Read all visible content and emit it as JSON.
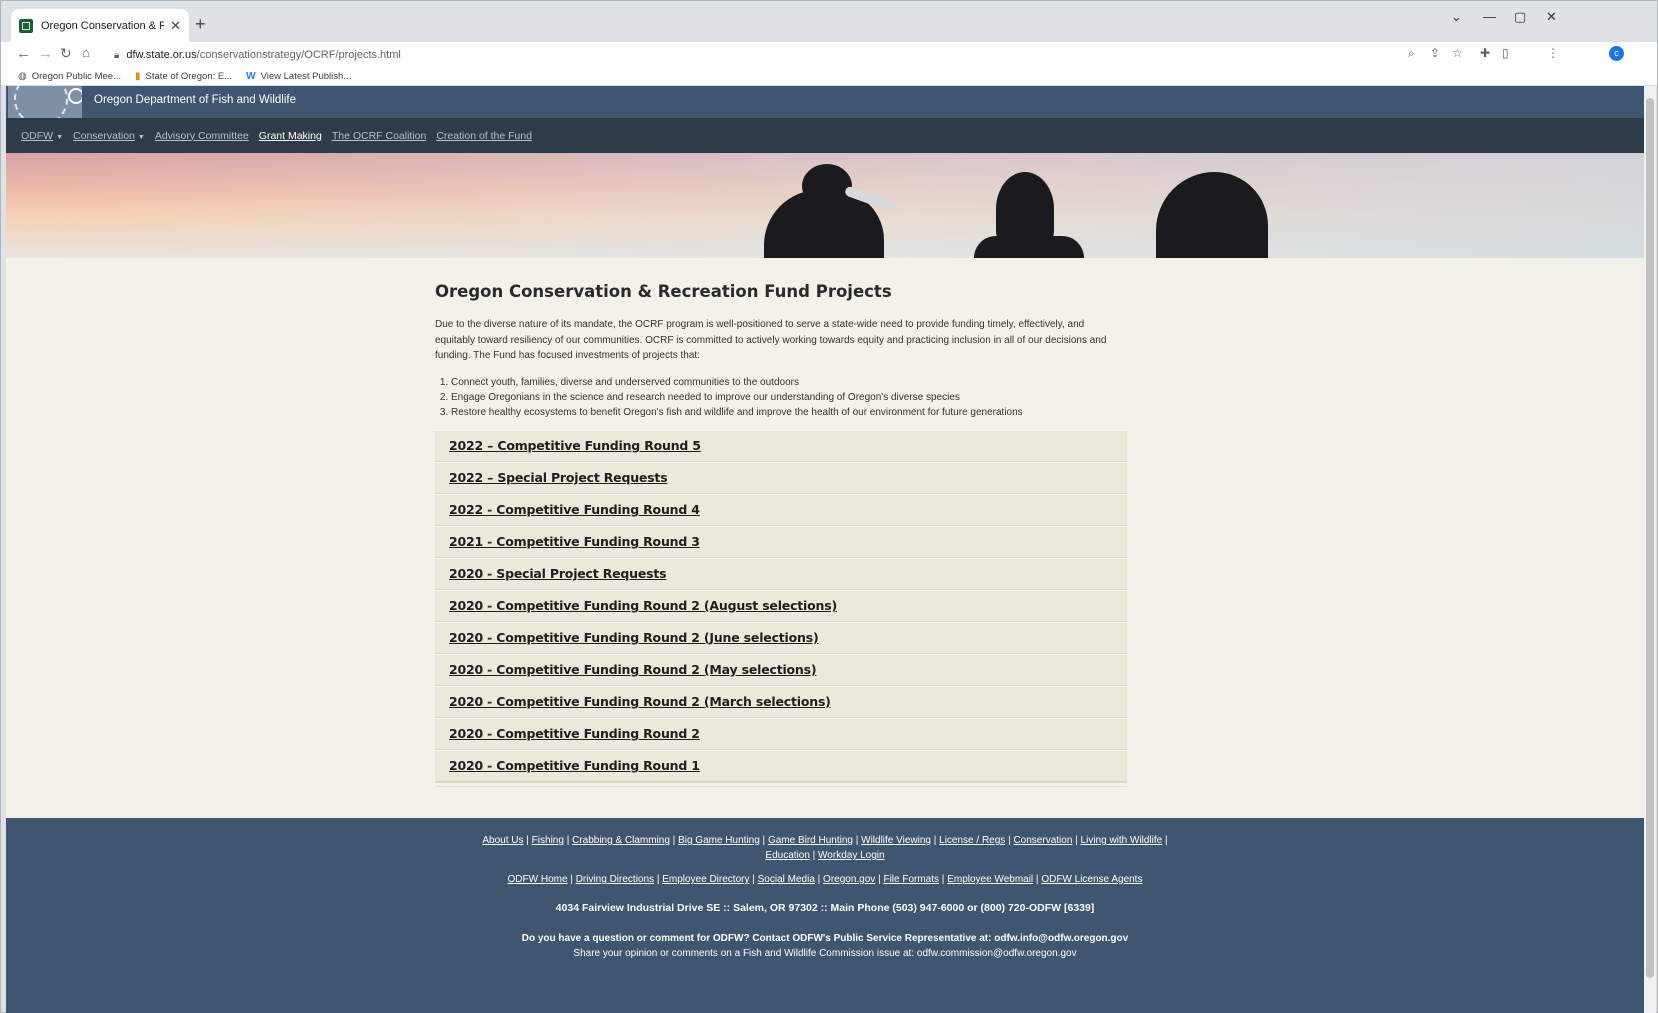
{
  "browser": {
    "tab_title": "Oregon Conservation & Recreation Fund Projects - ODFW",
    "url_host": "dfw.state.or.us",
    "url_path": "/conservationstrategy/OCRF/projects.html",
    "bookmarks": [
      {
        "label": "Oregon Public Mee...",
        "icon": "globe-icon"
      },
      {
        "label": "State of Oregon: E...",
        "icon": "oregon-flag-icon"
      },
      {
        "label": "View Latest Publish...",
        "icon": "w-logo-icon"
      }
    ],
    "profile_initial": "c",
    "accent": "#1a73e8"
  },
  "site": {
    "name": "Oregon Department of Fish and Wildlife",
    "nav": [
      {
        "label": "ODFW",
        "dropdown": true
      },
      {
        "label": "Conservation",
        "dropdown": true
      },
      {
        "label": "Advisory Committee",
        "dropdown": false
      },
      {
        "label": "Grant Making",
        "dropdown": false,
        "active": true
      },
      {
        "label": "The OCRF Coalition",
        "dropdown": false
      },
      {
        "label": "Creation of the Fund",
        "dropdown": false
      }
    ],
    "header_color": "#3f5570",
    "nav_color": "#2f3b48"
  },
  "main": {
    "title": "Oregon Conservation & Recreation Fund Projects",
    "intro": "Due to the diverse nature of its mandate, the OCRF program is well-positioned to serve a state-wide need to provide funding timely, effectively, and equitably toward resiliency of our communities. OCRF is committed to actively working towards equity and practicing inclusion in all of our decisions and funding. The Fund has focused investments of projects that:",
    "focus_items": [
      "Connect youth, families, diverse and underserved communities to the outdoors",
      "Engage Oregonians in the science and research needed to improve our understanding of Oregon's diverse species",
      "Restore healthy ecosystems to benefit Oregon's fish and wildlife and improve the health of our environment for future generations"
    ],
    "rounds": [
      "2022 – Competitive Funding Round 5",
      "2022 – Special Project Requests",
      "2022 - Competitive Funding Round 4",
      "2021 - Competitive Funding Round 3",
      "2020 - Special Project Requests",
      "2020 - Competitive Funding Round 2 (August selections)",
      "2020 - Competitive Funding Round 2 (June selections)",
      "2020 - Competitive Funding Round 2 (May selections)",
      "2020 - Competitive Funding Round 2 (March selections)",
      "2020 - Competitive Funding Round 2",
      "2020 - Competitive Funding Round 1"
    ]
  },
  "footer": {
    "links_row1": [
      "About Us",
      "Fishing",
      "Crabbing & Clamming",
      "Big Game Hunting",
      "Game Bird Hunting",
      "Wildlife Viewing",
      "License / Regs",
      "Conservation",
      "Living with Wildlife",
      "Education",
      "Workday Login"
    ],
    "links_row2": [
      "ODFW Home",
      "Driving Directions",
      "Employee Directory",
      "Social Media",
      "Oregon.gov",
      "File Formats",
      "Employee Webmail",
      "ODFW License Agents"
    ],
    "address": "4034 Fairview Industrial Drive SE  ::  Salem, OR 97302  ::  Main Phone (503) 947-6000 or (800) 720-ODFW [6339]",
    "contact": "Do you have a question or comment for ODFW? Contact ODFW's Public Service Representative at: odfw.info@odfw.oregon.gov",
    "commission": "Share your opinion or comments on a Fish and Wildlife Commission issue at: odfw.commission@odfw.oregon.gov"
  }
}
